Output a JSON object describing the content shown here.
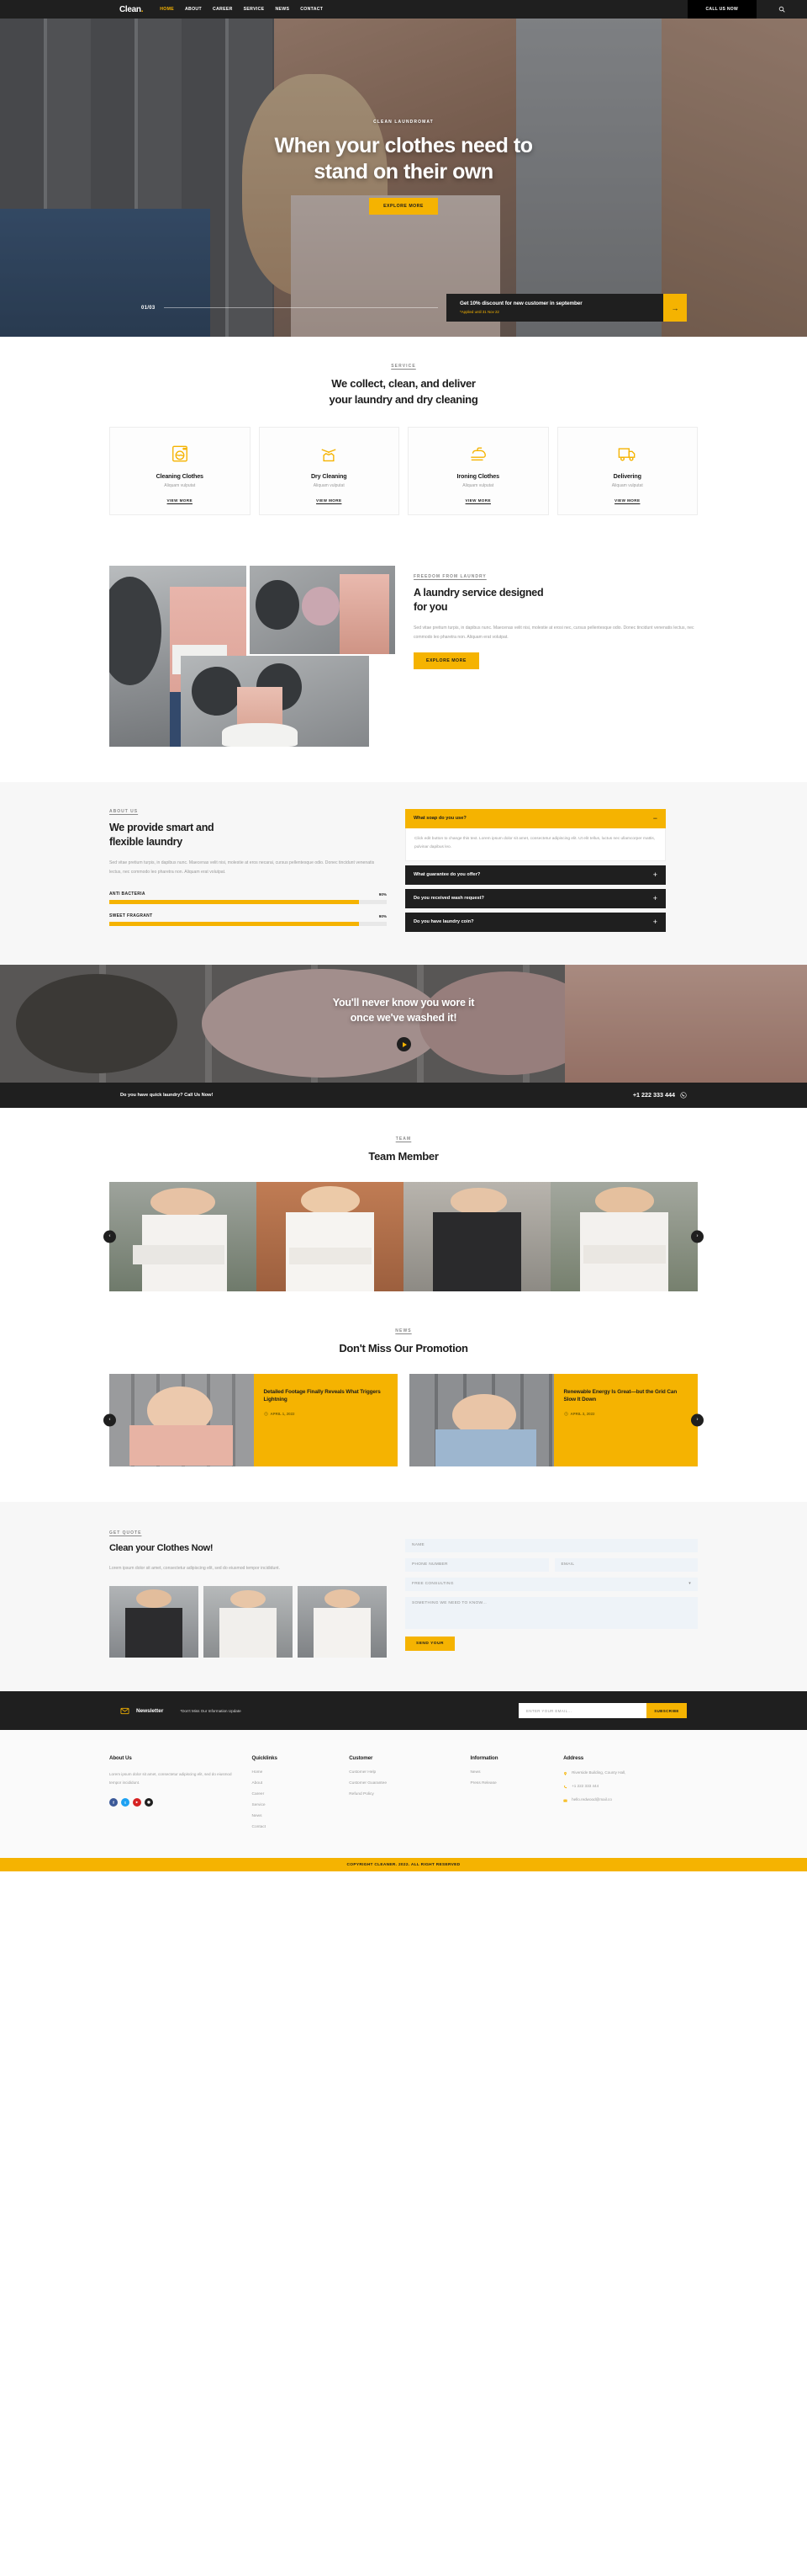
{
  "header": {
    "logo": "Clean",
    "logo_dot": ".",
    "nav": [
      {
        "label": "HOME",
        "active": true
      },
      {
        "label": "ABOUT",
        "active": false
      },
      {
        "label": "CAREER",
        "active": false
      },
      {
        "label": "SERVICE",
        "active": false
      },
      {
        "label": "NEWS",
        "active": false
      },
      {
        "label": "CONTACT",
        "active": false
      }
    ],
    "call_button": "CALL US NOW",
    "search_icon": "search-icon"
  },
  "hero": {
    "eyebrow": "CLEAN LAUNDROMAT",
    "title_line1": "When your clothes need to",
    "title_line2": "stand on their own",
    "button": "EXPLORE MORE",
    "counter": "01/03",
    "promo_title": "Get 10% discount for new customer in september",
    "promo_sub": "*Applied until 31 Nov 22",
    "promo_arrow": "→"
  },
  "service": {
    "eyebrow": "SERVICE",
    "title_line1": "We collect, clean, and deliver",
    "title_line2": "your laundry and dry cleaning",
    "cards": [
      {
        "icon": "washing-machine-icon",
        "title": "Cleaning Clothes",
        "sub": "Aliquam vulputat",
        "link": "VIEW MORE"
      },
      {
        "icon": "tshirt-hanger-icon",
        "title": "Dry Cleaning",
        "sub": "Aliquam vulputat",
        "link": "VIEW MORE"
      },
      {
        "icon": "iron-icon",
        "title": "Ironing Clothes",
        "sub": "Aliquam vulputat",
        "link": "VIEW MORE"
      },
      {
        "icon": "delivery-truck-icon",
        "title": "Delivering",
        "sub": "Aliquam vulputat",
        "link": "VIEW MORE"
      }
    ]
  },
  "designed": {
    "eyebrow": "FREEDOM FROM LAUNDRY",
    "title_line1": "A laundry service designed",
    "title_line2": "for you",
    "body": "Sed vitae pretium turpis, in dapibus nunc. Maecenas velit nisi, molestie at erosi nec, cursus pellentesque odio. Donec tincidunt venenatis lectus, nec commodo leo pharetra non. Aliquam erat volutpat.",
    "button": "EXPLORE MORE"
  },
  "about": {
    "eyebrow": "ABOUT US",
    "title_line1": "We provide smart and",
    "title_line2": "flexible laundry",
    "body": "Sed vitae pretium turpis, in dapibus nunc. Maecenas velit nisi, molestie at eros necarai, cursus pellentesque odio. Donec tincidunt venenatis lectus, nec commodo leo pharetra non. Aliquam erat volutpat.",
    "bars": [
      {
        "label": "ANTI BACTERIA",
        "value": "90%",
        "pct": 90
      },
      {
        "label": "SWEET FRAGRANT",
        "value": "90%",
        "pct": 90
      }
    ],
    "faq": [
      {
        "question": "What soap do you use?",
        "open": true,
        "sign": "−",
        "answer": "Click edit button to change this text. Lorem ipsum dolor sit amet, consectetur adipiscing elit. Ut elit tellus, luctus nec ullamcorper mattis, pulvinar dapibus leo."
      },
      {
        "question": "What guarantee do you offer?",
        "open": false,
        "sign": "+",
        "answer": ""
      },
      {
        "question": "Do you received wash request?",
        "open": false,
        "sign": "+",
        "answer": ""
      },
      {
        "question": "Do you have laundry coin?",
        "open": false,
        "sign": "+",
        "answer": ""
      }
    ]
  },
  "video": {
    "title_line1": "You'll never know you wore it",
    "title_line2": "once we've washed it!",
    "play_icon": "play-icon"
  },
  "callbar": {
    "text": "Do you have quick laundry? Call Us Now!",
    "phone": "+1 222 333 444",
    "icon": "whatsapp-icon"
  },
  "team": {
    "eyebrow": "TEAM",
    "title": "Team Member",
    "prev": "‹",
    "next": "›",
    "members": [
      {
        "name": "team-member-1"
      },
      {
        "name": "team-member-2"
      },
      {
        "name": "team-member-3"
      },
      {
        "name": "team-member-4"
      }
    ]
  },
  "news": {
    "eyebrow": "NEWS",
    "title": "Don't Miss Our Promotion",
    "prev": "‹",
    "next": "›",
    "items": [
      {
        "title": "Detailed Footage Finally Reveals What Triggers Lightning",
        "date": "APRIL 1, 2022"
      },
      {
        "title": "Renewable Energy Is Great—but the Grid Can Slow It Down",
        "date": "APRIL 3, 2022"
      }
    ]
  },
  "estimate": {
    "eyebrow": "GET QUOTE",
    "title": "Clean your Clothes Now!",
    "body": "Lorem ipsum dolor sit amet, consectetur adipiscing elit, sed do eiusmod tempor incididunt.",
    "form": {
      "name_placeholder": "NAME",
      "phone_placeholder": "PHONE NUMBER",
      "email_placeholder": "EMAIL",
      "select_value": "FREE CONSULTING",
      "select_caret": "▾",
      "message_placeholder": "SOMETHING WE NEED TO KNOW...",
      "submit": "SEND YOUR"
    }
  },
  "newsletter": {
    "icon": "envelope-icon",
    "title": "Newsletter",
    "subtitle": "*Don't Miss Our Information Update",
    "input_placeholder": "ENTER YOUR EMAIL...",
    "button": "SUBSCRIBE"
  },
  "footer": {
    "about": {
      "head": "About Us",
      "text": "Lorem ipsum dolor sit amet, consectetur adipiscing elit, sed do eiusmod tempor incididunt.",
      "socials": [
        {
          "name": "facebook-icon",
          "glyph": "f",
          "color": "#3b5998"
        },
        {
          "name": "twitter-icon",
          "glyph": "t",
          "color": "#1da1f2"
        },
        {
          "name": "youtube-icon",
          "glyph": "▸",
          "color": "#d62222"
        },
        {
          "name": "instagram-icon",
          "glyph": "◉",
          "color": "#1f1f1f"
        }
      ]
    },
    "quicklinks": {
      "head": "Quicklinks",
      "items": [
        "Home",
        "About",
        "Career",
        "Service",
        "News",
        "Contact"
      ]
    },
    "customer": {
      "head": "Customer",
      "items": [
        "Customer Help",
        "Customer Guarantee",
        "Refund Policy"
      ]
    },
    "information": {
      "head": "Information",
      "items": [
        "News",
        "Press Release"
      ]
    },
    "address": {
      "head": "Address",
      "rows": [
        {
          "icon": "location-pin-icon",
          "text": "Riverside Building, County Hall,"
        },
        {
          "icon": "phone-icon",
          "text": "+1 222 333 444"
        },
        {
          "icon": "mail-icon",
          "text": "hello.redwood@mail.co"
        }
      ]
    },
    "copyright": "COPYRIGHT CLEANER. 2022. ALL RIGHT RESERVED"
  },
  "colors": {
    "accent": "#f5b301",
    "dark": "#1f1f1f",
    "muted": "#9a9a9a",
    "field_bg": "#eef3f8"
  }
}
